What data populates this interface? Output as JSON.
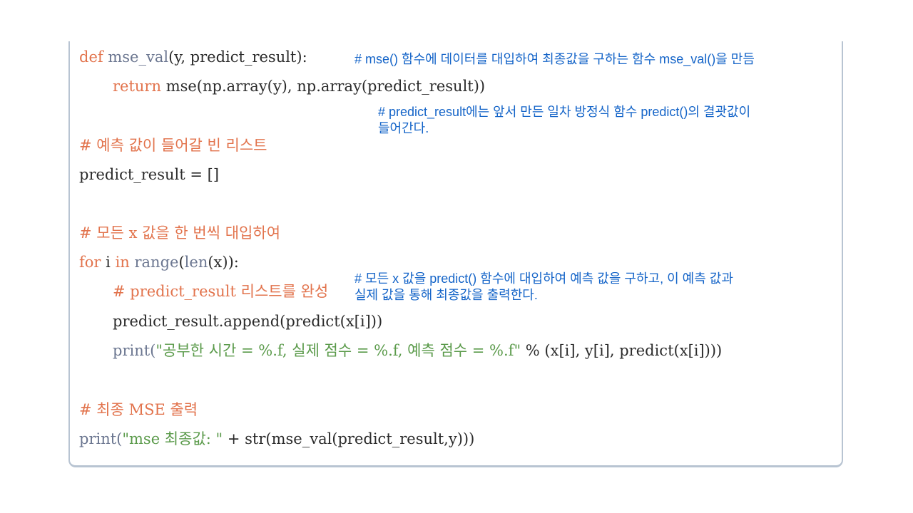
{
  "code": {
    "l1": {
      "def": "def",
      "name": "mse_val",
      "args": "(y, predict_result):"
    },
    "l2": {
      "ret": "return",
      "body": "mse(np.array(y), np.array(predict_result))"
    },
    "l3": "# 예측 값이 들어갈 빈 리스트",
    "l4": "predict_result = []",
    "l5": "# 모든 x 값을 한 번씩 대입하여",
    "l6": {
      "for": "for",
      "i": "i",
      "in": "in",
      "range": "range",
      "len": "len",
      "rest": "(x)):"
    },
    "l6_open": "(",
    "l7": "# predict_result 리스트를 완성",
    "l8": "predict_result.append(predict(x[i]))",
    "l9": {
      "print": "print(",
      "str": "\"공부한 시간 = %.f, 실제 점수 = %.f, 예측 점수 = %.f\"",
      "rest": " % (x[i], y[i], predict(x[i])))"
    },
    "l10": "# 최종 MSE 출력",
    "l11": {
      "print": "print(",
      "str": "\"mse 최종값: \"",
      "rest": " + str(mse_val(predict_result,y)))"
    }
  },
  "notes": {
    "n1": "# mse() 함수에 데이터를 대입하여 최종값을 구하는 함수 mse_val()을 만듬",
    "n2a": "# predict_result에는 앞서 만든 일차 방정식 함수 predict()의 결괏값이",
    "n2b": "들어간다.",
    "n3a": "# 모든 x 값을 predict() 함수에 대입하여 예측 값을 구하고, 이 예측 값과",
    "n3b": "실제 값을 통해 최종값을 출력한다."
  },
  "colors": {
    "keyword": "#e2734c",
    "note": "#1464c8",
    "string": "#5a9a4a",
    "border": "#b8c4d2"
  }
}
